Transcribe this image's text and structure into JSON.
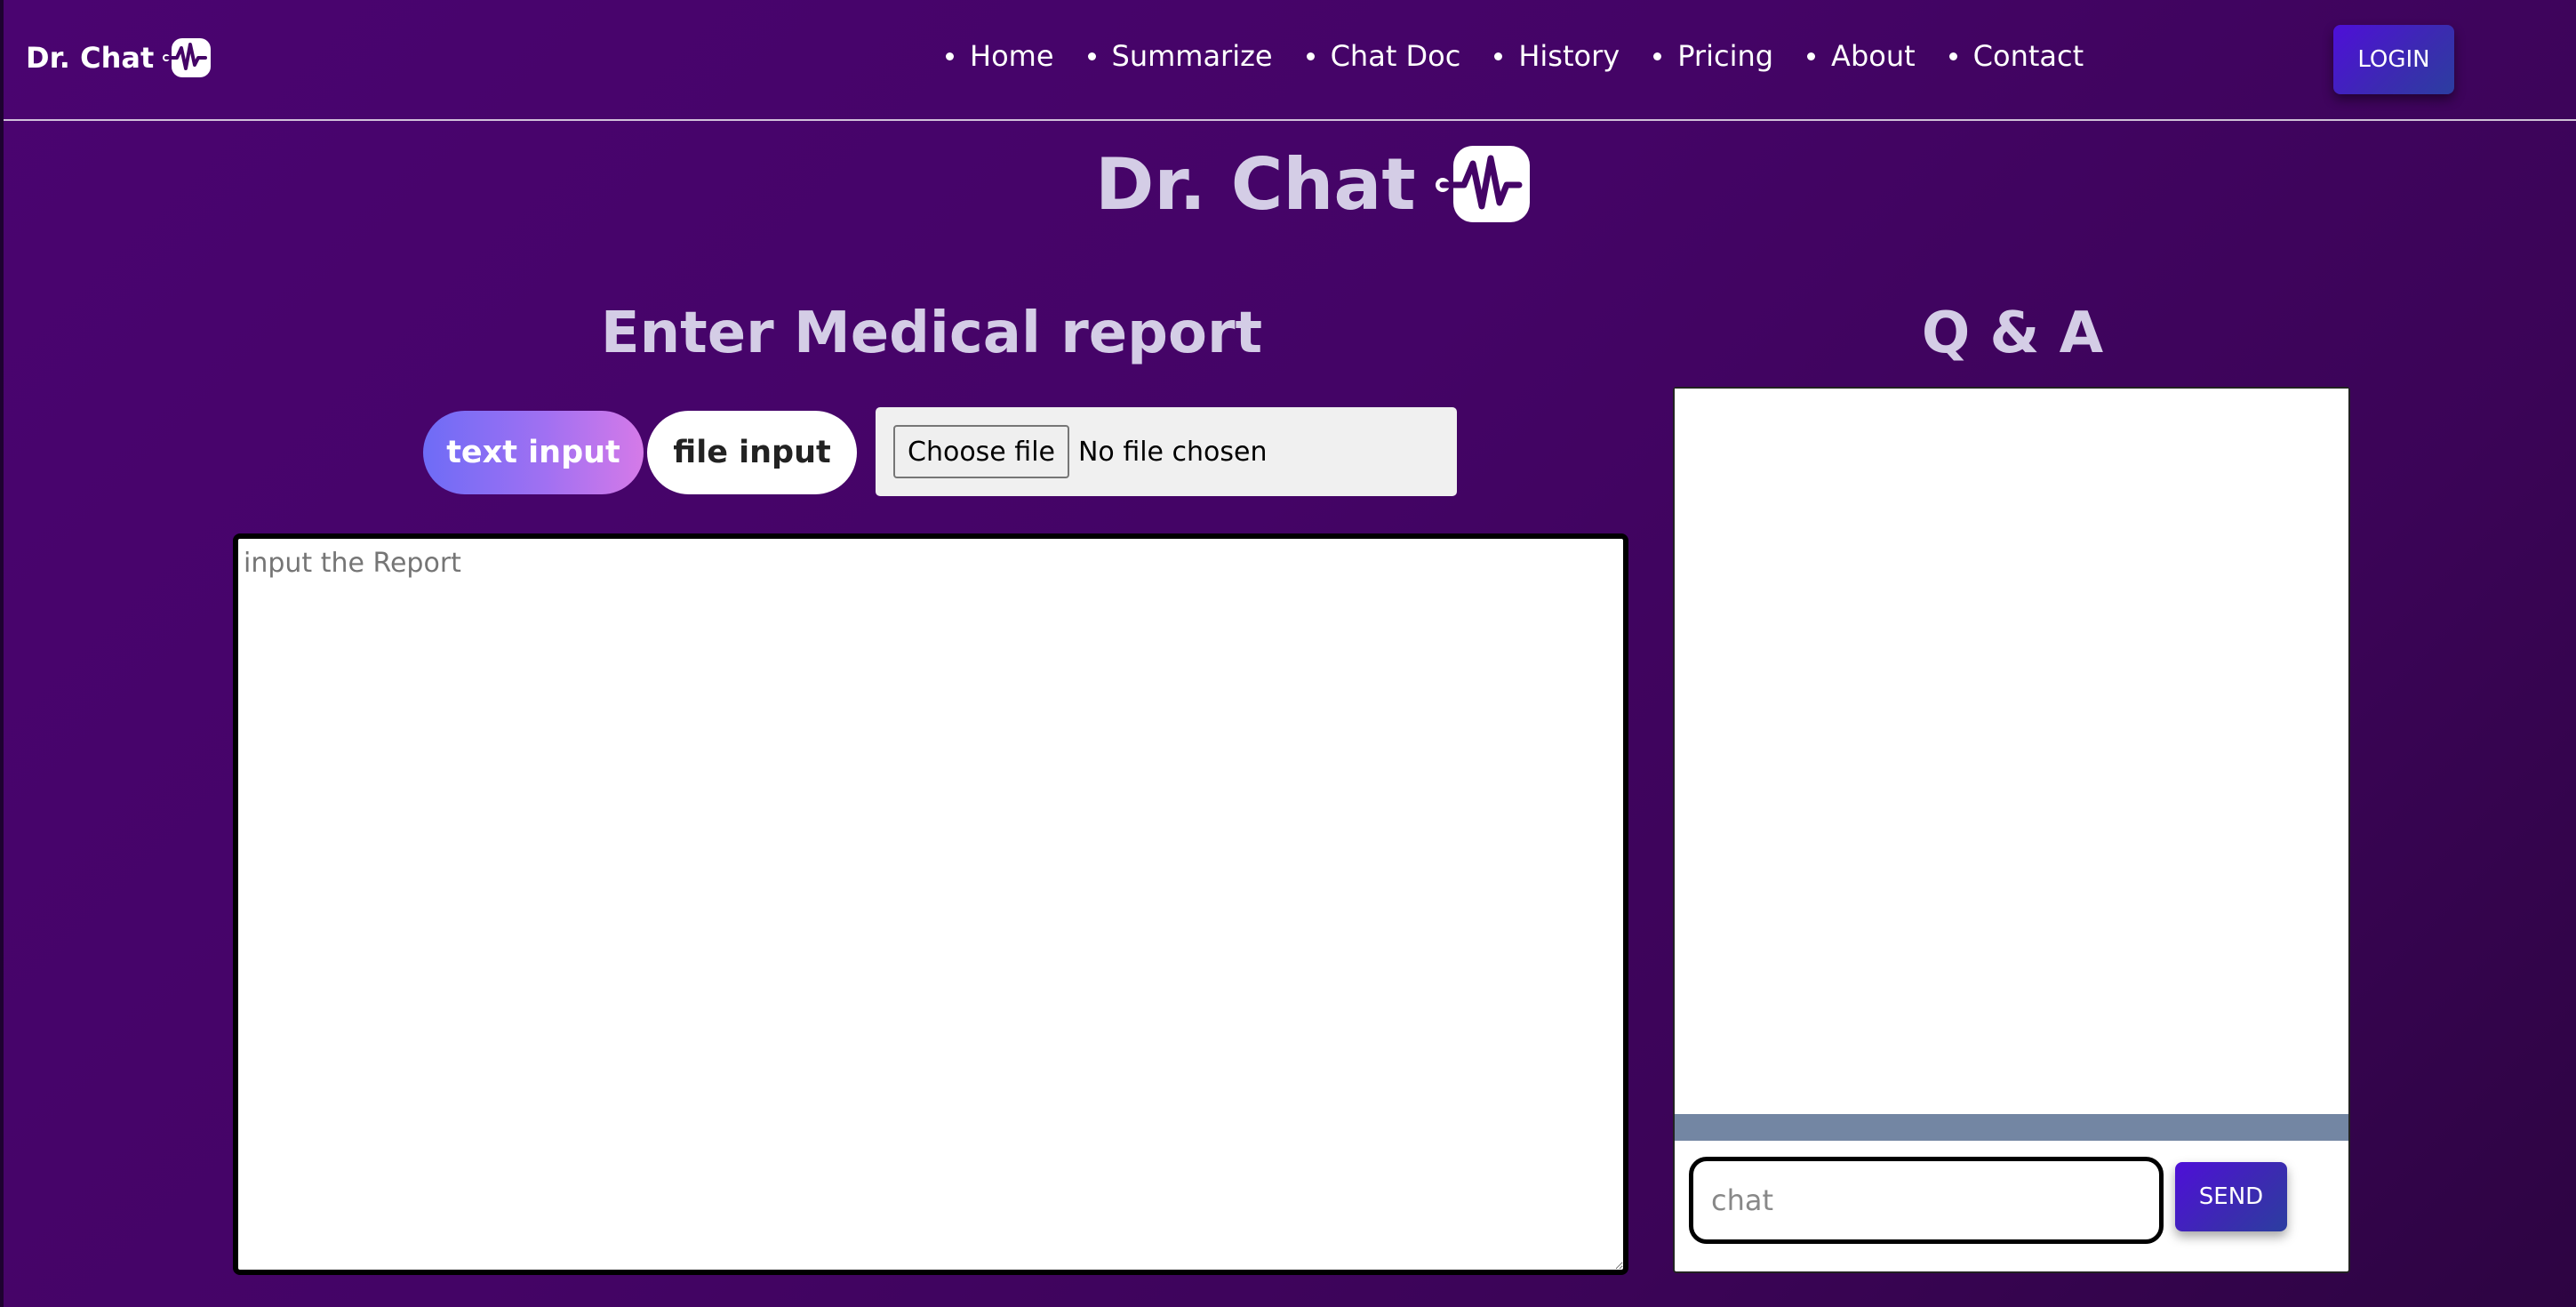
{
  "header": {
    "brand": "Dr. Chat",
    "nav": [
      "Home",
      "Summarize",
      "Chat Doc",
      "History",
      "Pricing",
      "About",
      "Contact"
    ],
    "login_label": "LOGIN"
  },
  "hero": {
    "title": "Dr. Chat",
    "logo_icon": "heartbeat-icon"
  },
  "report": {
    "heading": "Enter Medical report",
    "toggle_text_label": "text input",
    "toggle_file_label": "file input",
    "choose_file_label": "Choose file",
    "no_file_label": "No file chosen",
    "placeholder": "input the Report",
    "value": ""
  },
  "qa": {
    "heading": "Q & A",
    "chat_placeholder": "chat",
    "send_label": "SEND",
    "messages": []
  },
  "colors": {
    "background": "#440466",
    "accent_gradient_start": "#6e6cf6",
    "accent_gradient_end": "#d57ae8",
    "button_gradient_start": "#4e0fd8",
    "button_gradient_end": "#2b3ea0",
    "heading_text": "#d4cde6"
  }
}
